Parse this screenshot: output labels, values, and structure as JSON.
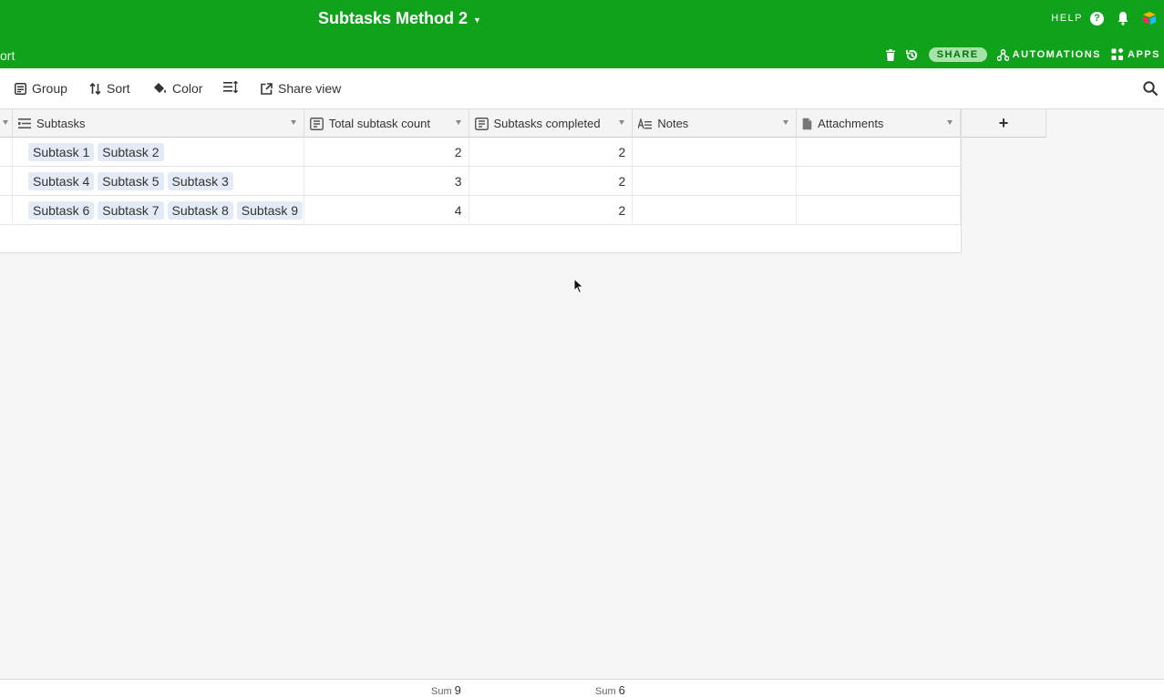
{
  "header": {
    "base_title": "Subtasks Method 2",
    "help_label": "HELP",
    "help_icon_glyph": "?",
    "tab_partial": "ort",
    "share_label": "SHARE",
    "automations_label": "AUTOMATIONS",
    "apps_label": "APPS",
    "bg_color": "#11a21b"
  },
  "toolbar": {
    "group_label": "Group",
    "sort_label": "Sort",
    "color_label": "Color",
    "share_view_label": "Share view"
  },
  "columns": [
    {
      "label": "Subtasks",
      "icon": "linked-record-icon"
    },
    {
      "label": "Total subtask count",
      "icon": "count-icon"
    },
    {
      "label": "Subtasks completed",
      "icon": "count-icon"
    },
    {
      "label": "Notes",
      "icon": "long-text-icon"
    },
    {
      "label": "Attachments",
      "icon": "attachment-icon"
    }
  ],
  "add_column_label": "+",
  "rows": [
    {
      "subtasks": [
        "Subtask 1",
        "Subtask 2"
      ],
      "total": "2",
      "completed": "2",
      "notes": "",
      "attachments": ""
    },
    {
      "subtasks": [
        "Subtask 4",
        "Subtask 5",
        "Subtask 3"
      ],
      "total": "3",
      "completed": "2",
      "notes": "",
      "attachments": ""
    },
    {
      "subtasks": [
        "Subtask 6",
        "Subtask 7",
        "Subtask 8",
        "Subtask 9"
      ],
      "total": "4",
      "completed": "2",
      "notes": "",
      "attachments": ""
    }
  ],
  "footer": {
    "sum_label": "Sum",
    "total_sum": "9",
    "completed_sum": "6"
  }
}
